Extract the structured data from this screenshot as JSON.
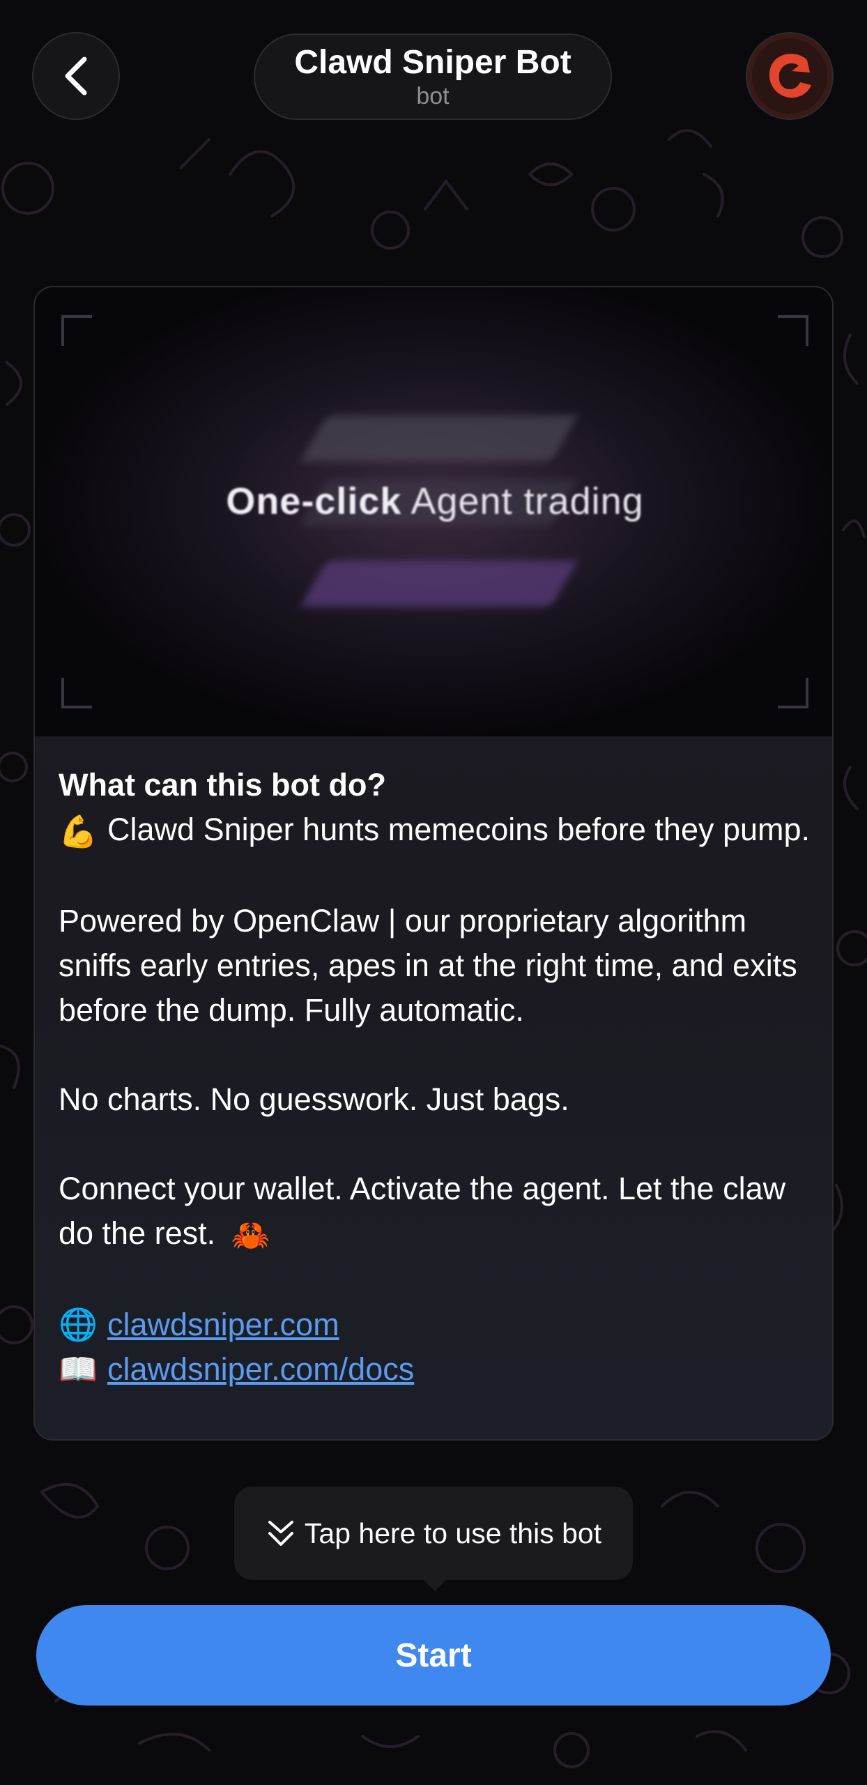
{
  "header": {
    "title": "Clawd Sniper Bot",
    "subtitle": "bot",
    "back_icon": "chevron-left-icon",
    "avatar_icon": "clawd-logo-icon"
  },
  "media": {
    "text_bold": "One-click",
    "text_regular": "Agent trading"
  },
  "description": {
    "heading": "What can this bot do?",
    "line1_emoji": "💪",
    "line1": "Clawd Sniper hunts memecoins before they pump.",
    "para2": "Powered by OpenClaw | our proprietary algorithm sniffs early entries, apes in at the right time, and exits before the dump. Fully automatic.",
    "para3": "No charts. No guesswork. Just bags.",
    "para4": "Connect your wallet. Activate the agent. Let the claw do the rest.",
    "para4_emoji": "🦀",
    "links": [
      {
        "emoji": "🌐",
        "text": "clawdsniper.com"
      },
      {
        "emoji": "📖",
        "text": "clawdsniper.com/docs"
      }
    ]
  },
  "tooltip": {
    "text": "Tap here to use this bot",
    "icon": "double-chevron-down-icon"
  },
  "start_button": {
    "label": "Start"
  },
  "colors": {
    "accent": "#3e88f0",
    "link": "#5b9bf0",
    "avatar_brand": "#e2452b"
  }
}
